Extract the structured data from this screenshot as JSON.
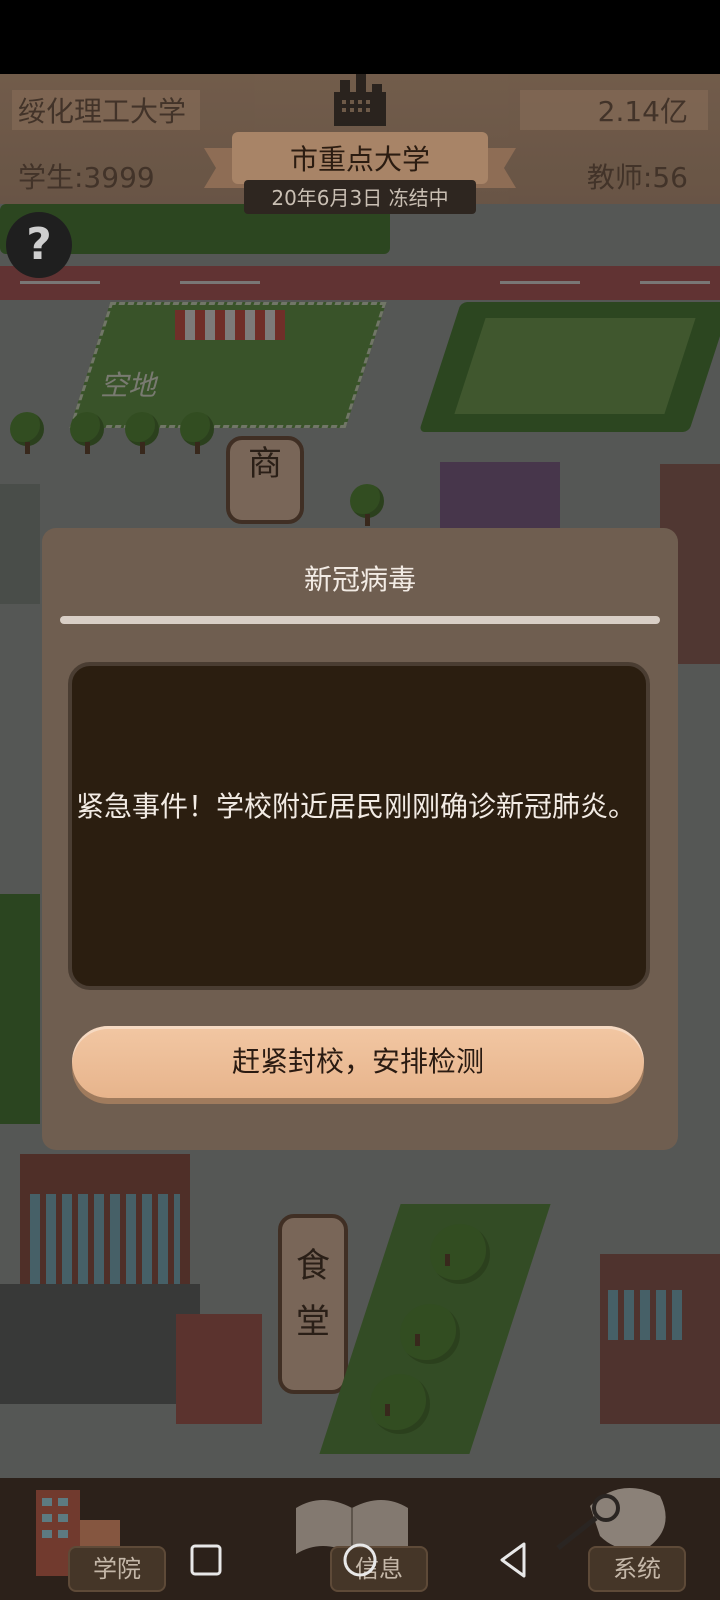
{
  "header": {
    "school_name": "绥化理工大学",
    "funds": "2.14亿",
    "students": "学生:3999",
    "teachers": "教师:56",
    "school_rank": "市重点大学",
    "date_status": "20年6月3日 冻结中"
  },
  "map_labels": {
    "empty_lot": "空地",
    "shop_sign": "商",
    "canteen_sign_1": "食",
    "canteen_sign_2": "堂"
  },
  "help": {
    "label": "?"
  },
  "dialog": {
    "title": "新冠病毒",
    "message": "紧急事件！学校附近居民刚刚确诊新冠肺炎。",
    "action_label": "赶紧封校，安排检测"
  },
  "tabs": [
    {
      "label": "学院",
      "icon": "building-icon"
    },
    {
      "label": "信息",
      "icon": "book-icon"
    },
    {
      "label": "系统",
      "icon": "magnifier-icon"
    }
  ],
  "system_nav": {
    "recent_icon": "square-icon",
    "home_icon": "circle-icon",
    "back_icon": "triangle-back-icon"
  },
  "colors": {
    "dialog_bg": "#6f5e50",
    "message_bg": "#2b1e10",
    "button_bg": "#f2c7a3",
    "road": "#b35256"
  }
}
